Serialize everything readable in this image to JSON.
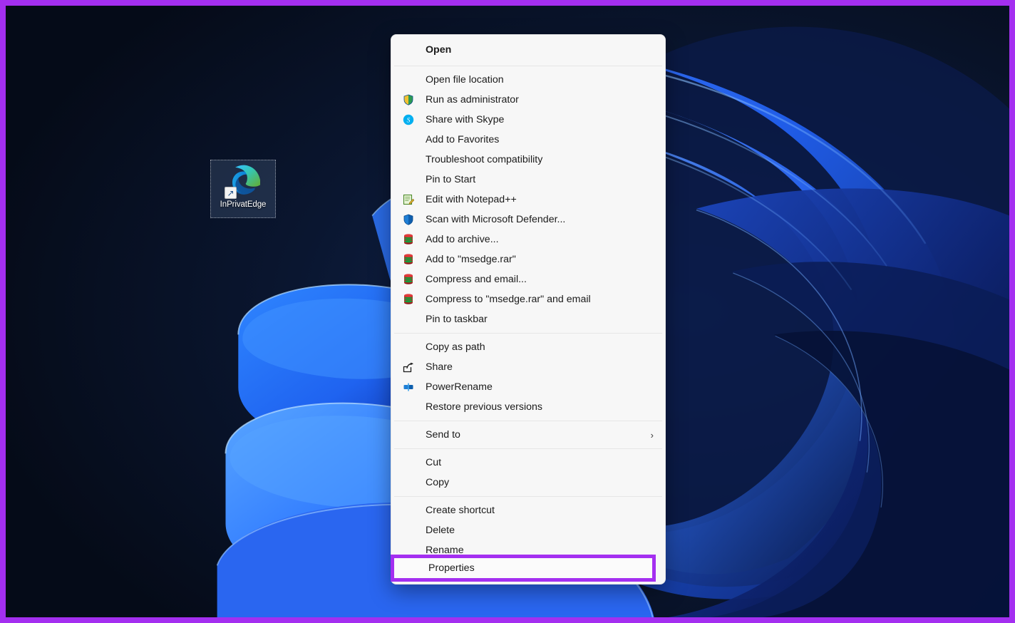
{
  "screen": {
    "highlight_border_color": "#a42ff0",
    "desktop_bg_color": "#081226"
  },
  "desktop": {
    "icon": {
      "label": "InPrivatEdge",
      "icon_name": "microsoft-edge-icon",
      "overlay_name": "shortcut-arrow-icon",
      "overlay_glyph": "↗"
    }
  },
  "context_menu": {
    "groups": [
      {
        "items": [
          {
            "label": "Open",
            "icon": "none",
            "header": true
          }
        ]
      },
      {
        "items": [
          {
            "label": "Open file location",
            "icon": "none"
          },
          {
            "label": "Run as administrator",
            "icon": "uac-shield-icon"
          },
          {
            "label": "Share with Skype",
            "icon": "skype-icon"
          },
          {
            "label": "Add to Favorites",
            "icon": "none"
          },
          {
            "label": "Troubleshoot compatibility",
            "icon": "none"
          },
          {
            "label": "Pin to Start",
            "icon": "none"
          },
          {
            "label": "Edit with Notepad++",
            "icon": "notepadpp-icon"
          },
          {
            "label": "Scan with Microsoft Defender...",
            "icon": "defender-shield-icon"
          },
          {
            "label": "Add to archive...",
            "icon": "winrar-icon"
          },
          {
            "label": "Add to \"msedge.rar\"",
            "icon": "winrar-icon"
          },
          {
            "label": "Compress and email...",
            "icon": "winrar-icon"
          },
          {
            "label": "Compress to \"msedge.rar\" and email",
            "icon": "winrar-icon"
          },
          {
            "label": "Pin to taskbar",
            "icon": "none"
          }
        ]
      },
      {
        "items": [
          {
            "label": "Copy as path",
            "icon": "none"
          },
          {
            "label": "Share",
            "icon": "share-icon"
          },
          {
            "label": "PowerRename",
            "icon": "powerrename-icon"
          },
          {
            "label": "Restore previous versions",
            "icon": "none"
          }
        ]
      },
      {
        "items": [
          {
            "label": "Send to",
            "icon": "none",
            "submenu": true,
            "chevron": "›"
          }
        ]
      },
      {
        "items": [
          {
            "label": "Cut",
            "icon": "none"
          },
          {
            "label": "Copy",
            "icon": "none"
          }
        ]
      },
      {
        "items": [
          {
            "label": "Create shortcut",
            "icon": "none"
          },
          {
            "label": "Delete",
            "icon": "none"
          },
          {
            "label": "Rename",
            "icon": "none"
          }
        ]
      }
    ],
    "highlighted_item": {
      "label": "Properties",
      "icon": "none"
    }
  }
}
